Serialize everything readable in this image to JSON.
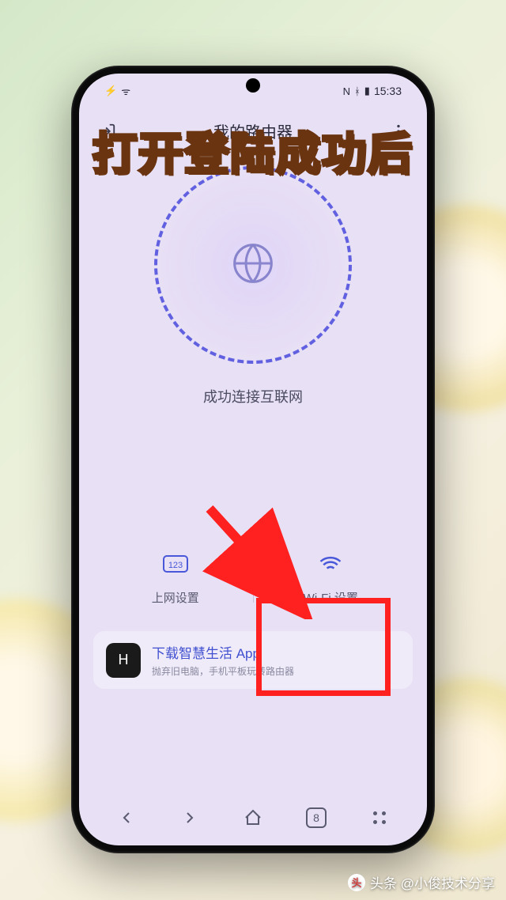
{
  "overlay": {
    "caption": "打开登陆成功后"
  },
  "status_bar": {
    "carrier_icon": "⚡",
    "wifi_icon": "ᯤ",
    "nfc": "N",
    "bluetooth": "ᚼ",
    "battery": "▮",
    "time": "15:33"
  },
  "header": {
    "title": "我的路由器"
  },
  "connection": {
    "status_text": "成功连接互联网"
  },
  "actions": {
    "internet": {
      "label": "上网设置"
    },
    "wifi": {
      "label": "Wi-Fi 设置"
    }
  },
  "download": {
    "icon_glyph": "H",
    "title": "下载智慧生活 App",
    "subtitle": "抛弃旧电脑，手机平板玩转路由器"
  },
  "bottom_nav": {
    "tab_count": "8"
  },
  "watermark": {
    "icon": "头",
    "text": "头条 @小俊技术分享"
  }
}
